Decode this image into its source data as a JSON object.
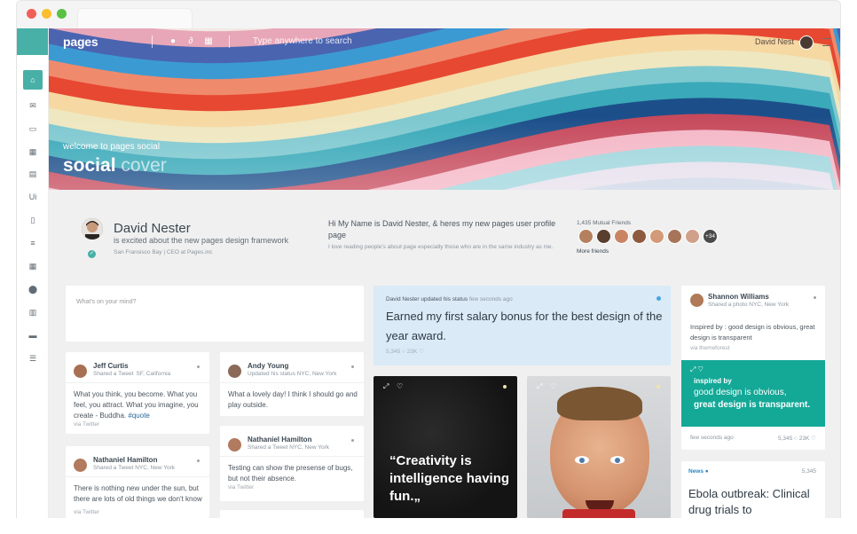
{
  "header": {
    "logo": "pages",
    "search_placeholder": "Type anywhere to search",
    "user_name": "David Nest"
  },
  "sidebar": {
    "items": [
      {
        "icon": "home-icon",
        "glyph": "⌂",
        "active": true
      },
      {
        "icon": "mail-icon",
        "glyph": "✉"
      },
      {
        "icon": "chat-icon",
        "glyph": "▭"
      },
      {
        "icon": "calendar-icon",
        "glyph": "▦"
      },
      {
        "icon": "builder-icon",
        "glyph": "▤"
      },
      {
        "icon": "ui-icon",
        "glyph": "Ui"
      },
      {
        "icon": "file-icon",
        "glyph": "▯"
      },
      {
        "icon": "menu-icon",
        "glyph": "≡"
      },
      {
        "icon": "table-icon",
        "glyph": "▦"
      },
      {
        "icon": "map-pin-icon",
        "glyph": "⬤"
      },
      {
        "icon": "chart-icon",
        "glyph": "▥"
      },
      {
        "icon": "briefcase-icon",
        "glyph": "▬"
      },
      {
        "icon": "list-icon",
        "glyph": "☰"
      }
    ]
  },
  "cover": {
    "subtitle": "welcome to pages social",
    "title_bold": "social",
    "title_light": "cover"
  },
  "profile": {
    "name": "David Nester",
    "description": "is excited about the new pages design framework",
    "location": "San Fransisco Bay | CEO at Pages.inc",
    "intro": "Hi My Name is David Nester, & heres my new pages user profile page",
    "intro_small": "I love reading people's about page especially those who are in the same industry as me.",
    "mutual_friends": "1,435 Mutual Friends",
    "more_friends_badge": "+34",
    "more_friends_link": "More friends"
  },
  "status_box": {
    "placeholder": "What's on your mind?"
  },
  "posts": [
    {
      "name": "Jeff Curtis",
      "shared": "Shared a Tweet  SF, California",
      "text": "What you think, you become. What you feel, you attract. What you imagine, you create - Buddha.",
      "hashtag": "#quote",
      "via": "via Twitter"
    },
    {
      "name": "Nathaniel Hamilton",
      "shared": "Shared a Tweet NYC, New York",
      "text": "There is nothing new under the sun, but there are lots of old things we don't know",
      "via": "via Twitter"
    },
    {
      "name": "Andy Young",
      "shared": "Updated his status NYC, New York",
      "text": "What a lovely day! I think I should go and play outside.",
      "via": ""
    },
    {
      "name": "Nathaniel Hamilton",
      "shared": "Shared a Tweet NYC, New York",
      "text": "Testing can show the presense of bugs, but not their absence.",
      "via": "via Twitter"
    }
  ],
  "highlight": {
    "author": "David Nester",
    "action": "updated his status",
    "time": "few seconds ago",
    "text": "Earned my first salary bonus for the best design of the year award.",
    "stats": "5,345 ○ 23K ♡"
  },
  "quote_card": {
    "quote": "“Creativity is intelligence having fun.„"
  },
  "right_card": {
    "name": "Shannon Williams",
    "shared": "Shared a photo NYC, New York",
    "text": "Inspired by : good design is obvious, great design is transparent",
    "via": "via themeforest",
    "teal_label": "inspired by",
    "teal_quote_1": "good design is obvious,",
    "teal_quote_2": "great design is transparent.",
    "ago": "few seconds ago",
    "stats": "5,345 ○ 23K ♡"
  },
  "news": {
    "tag": "News",
    "count": "5,345",
    "headline": "Ebola outbreak: Clinical drug trials to"
  },
  "colors": {
    "accent": "#48b0a6",
    "teal_card": "#14a897",
    "highlight_bg": "#daeaf7"
  }
}
